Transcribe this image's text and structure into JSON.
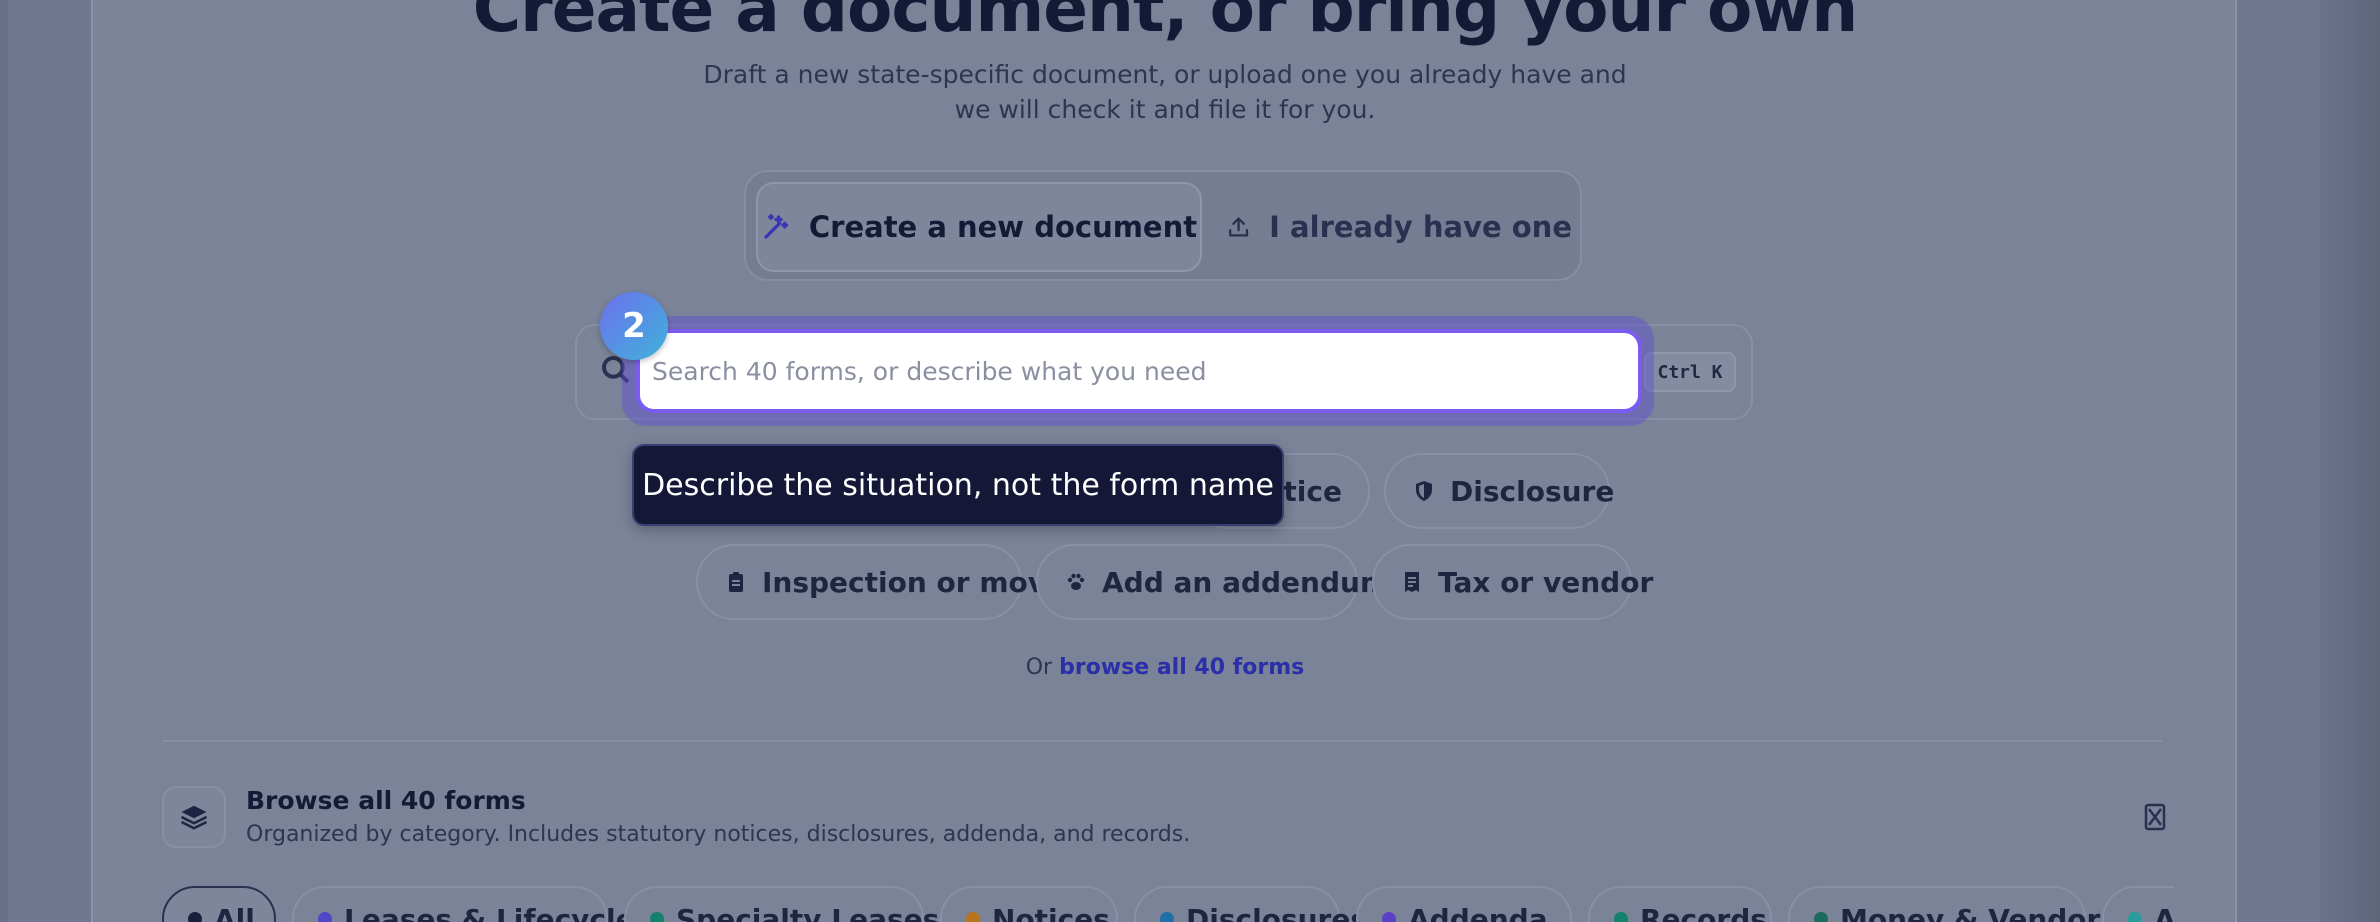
{
  "header": {
    "title": "Create a document, or bring your own",
    "subtitle": "Draft a new state-specific document, or upload one you already have and we will check it and file it for you."
  },
  "mode_toggle": {
    "create_label": "Create a new document",
    "upload_label": "I already have one"
  },
  "search": {
    "placeholder": "Search 40 forms, or describe what you need",
    "shortcut": "Ctrl K"
  },
  "onboarding": {
    "step_number": "2",
    "tooltip": "Describe the situation, not the form name"
  },
  "chips": {
    "notice": "otice",
    "disclosure": "Disclosure",
    "inspection": "Inspection or move",
    "addendum": "Add an addendum",
    "tax": "Tax or vendor"
  },
  "browse": {
    "prefix": "Or",
    "link": "browse all 40 forms"
  },
  "forms_section": {
    "title": "Browse all 40 forms",
    "description": "Organized by category. Includes statutory notices, disclosures, addenda, and records."
  },
  "categories": [
    {
      "label": "All",
      "color": "#1b1f3b"
    },
    {
      "label": "Leases & Lifecycle",
      "color": "#4f46c8"
    },
    {
      "label": "Specialty Leases",
      "color": "#14806e"
    },
    {
      "label": "Notices",
      "color": "#b8741a"
    },
    {
      "label": "Disclosures",
      "color": "#1f6fa8"
    },
    {
      "label": "Addenda",
      "color": "#5b3fc4"
    },
    {
      "label": "Records",
      "color": "#14806e"
    },
    {
      "label": "Money & Vendor",
      "color": "#1d6b5c"
    },
    {
      "label": "Apr",
      "color": "#2a9d9a"
    }
  ],
  "colors": {
    "accent": "#7b5cf0",
    "link": "#2b2fa8",
    "tooltip_bg": "#141836"
  }
}
